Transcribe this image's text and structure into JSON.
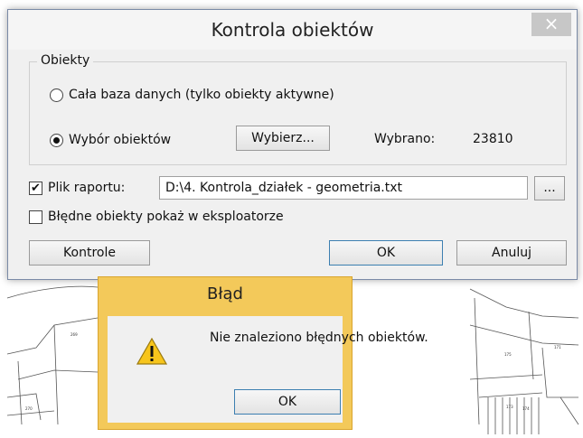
{
  "dialog": {
    "title": "Kontrola obiektów",
    "close_glyph": "×",
    "group": {
      "legend": "Obiekty",
      "option_all": "Cała baza danych (tylko obiekty aktywne)",
      "option_selection": "Wybór obiektów",
      "selected_option": "option_selection",
      "choose_button": "Wybierz...",
      "selected_label": "Wybrano:",
      "selected_count": "23810"
    },
    "report": {
      "checkbox_label": "Plik raportu:",
      "checked": true,
      "path": "D:\\4. Kontrola_działek - geometria.txt",
      "browse_button": "..."
    },
    "explorer": {
      "checkbox_label": "Błędne obiekty pokaż w eksploatorze",
      "checked": false
    },
    "buttons": {
      "controls": "Kontrole",
      "ok": "OK",
      "cancel": "Anuluj"
    }
  },
  "error_dialog": {
    "title": "Błąd",
    "message": "Nie znaleziono błędnych obiektów.",
    "ok": "OK",
    "icon": "warning-icon"
  },
  "map_labels": [
    "269",
    "270",
    "175",
    "171",
    "173",
    "174"
  ],
  "colors": {
    "error_frame": "#f3c95a",
    "dialog_bg": "#f0f0f0",
    "close_button": "#c7c7c7"
  }
}
